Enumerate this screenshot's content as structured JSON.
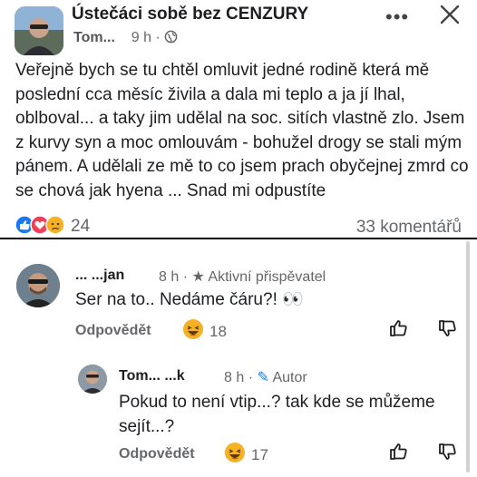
{
  "post": {
    "group_title": "Ústečáci sobě bez CENZURY",
    "author": "Tom...",
    "time": "9 h",
    "text": "Veřejně bych se tu chtěl omluvit jedné rodině která mě poslední cca měsíc živila a dala mi teplo a ja jí lhal, oblboval... a taky jim udělal na soc. sitích vlastně zlo. Jsem z kurvy syn a moc omlouvám - bohužel drogy se stali mým pánem. A udělali ze mě to co jsem prach obyčejnej zmrd co se chová jak hyena ... Snad mi odpustíte",
    "reaction_count": "24",
    "comments_label": "33 komentářů",
    "more_icon": "more-dots-icon",
    "close_icon": "close-icon"
  },
  "comments": [
    {
      "author": "... ...jan",
      "time": "8 h",
      "badge": "Aktivní přispěvatel",
      "text": "Ser na to.. Nedáme čáru?! 👀",
      "reply_label": "Odpovědět",
      "reaction_count": "18"
    },
    {
      "author": "Tom... ...k",
      "time": "8 h",
      "badge": "Autor",
      "text": "Pokud to není vtip...? tak kde se můžeme sejít...?",
      "reply_label": "Odpovědět",
      "reaction_count": "17"
    }
  ],
  "colors": {
    "like_blue": "#1877f2",
    "haha_yellow": "#f7b125",
    "meta_gray": "#65676b"
  }
}
